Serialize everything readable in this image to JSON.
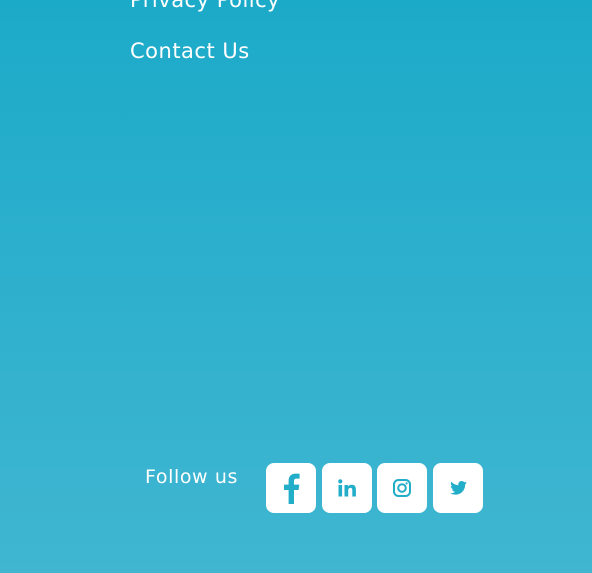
{
  "footer": {
    "links": {
      "privacy": "Privacy Policy",
      "contact": "Contact Us"
    },
    "follow_label": "Follow us",
    "social": [
      {
        "icon": "facebook-icon"
      },
      {
        "icon": "linkedin-icon"
      },
      {
        "icon": "instagram-icon"
      },
      {
        "icon": "twitter-icon"
      }
    ],
    "colors": {
      "background_top": "#1caac9",
      "background_bottom": "#40b6d1",
      "icon_color": "#22adc9",
      "text": "#ffffff"
    }
  }
}
